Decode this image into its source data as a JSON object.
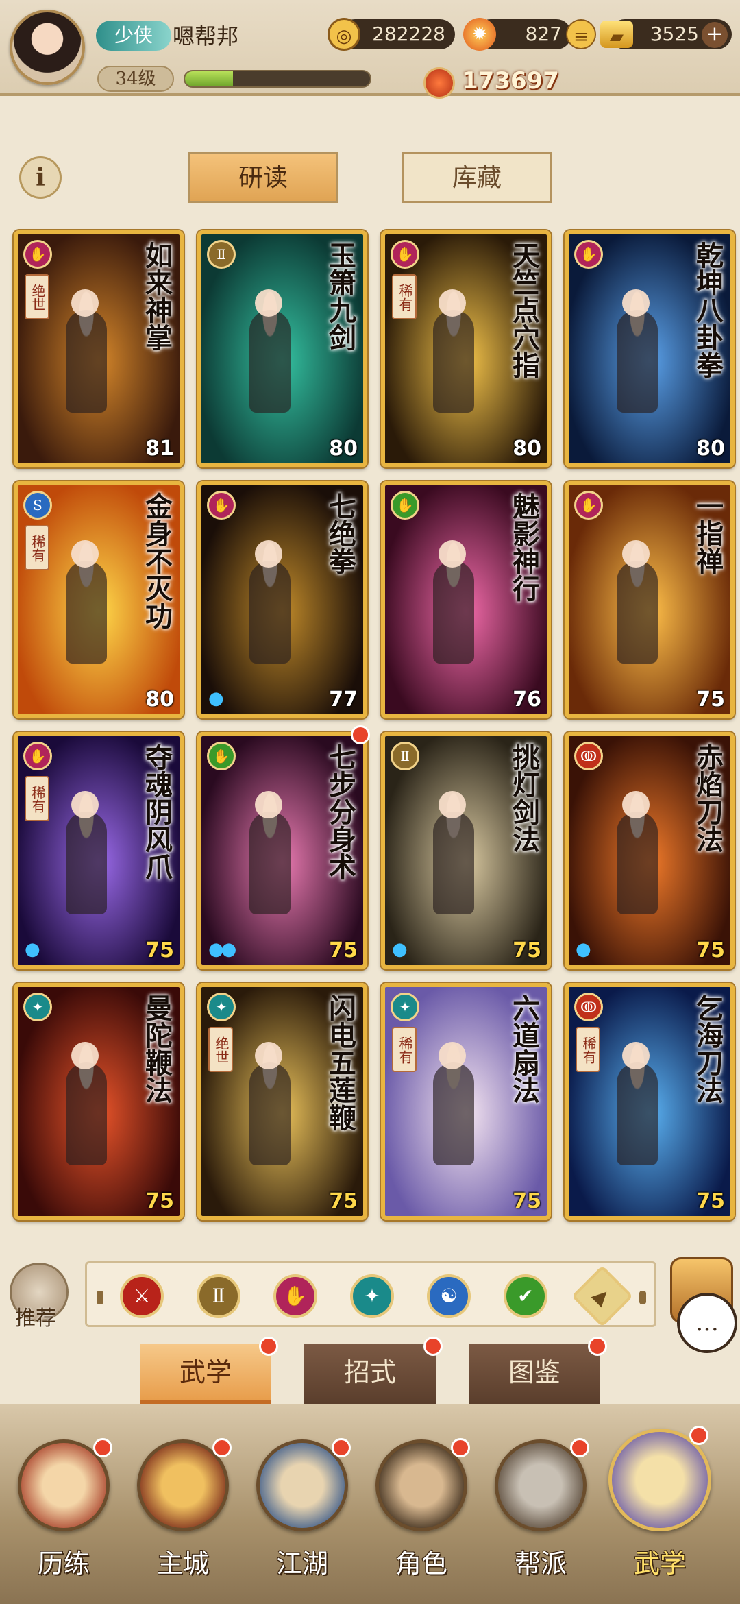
{
  "player": {
    "title_badge": "少侠",
    "name": "嗯帮邦",
    "level": "34级",
    "exp_fraction": 0.26,
    "power": "173697"
  },
  "resources": {
    "coins": "282228",
    "stamina": "827",
    "gold": "3525",
    "plus_icon": "plus-icon"
  },
  "header": {
    "info_symbol": "i",
    "tabs": [
      "研读",
      "库藏"
    ]
  },
  "cards": [
    {
      "name": "如来神掌",
      "level": "81",
      "rarity": "绝世",
      "type_color": "#b0245a",
      "bg": [
        "#3a1a0c",
        "#d4862a"
      ],
      "drops": 0
    },
    {
      "name": "玉箫九剑",
      "level": "80",
      "rarity": "",
      "type_color": "#8a6a2a",
      "bg": [
        "#0c3a34",
        "#34c0a0"
      ],
      "drops": 0
    },
    {
      "name": "天竺点穴指",
      "level": "80",
      "rarity": "稀有",
      "type_color": "#b0245a",
      "bg": [
        "#2a1a08",
        "#f2c24a"
      ],
      "drops": 0
    },
    {
      "name": "乾坤八卦拳",
      "level": "80",
      "rarity": "",
      "type_color": "#b0245a",
      "bg": [
        "#0a1a3a",
        "#5aa0e8"
      ],
      "drops": 0
    },
    {
      "name": "金身不灭功",
      "level": "80",
      "rarity": "稀有",
      "type_color": "#2a6ac0",
      "bg": [
        "#c04a0a",
        "#ffd84a"
      ],
      "drops": 0
    },
    {
      "name": "七绝拳",
      "level": "77",
      "rarity": "",
      "type_color": "#b0245a",
      "bg": [
        "#1a0e08",
        "#c08a2a"
      ],
      "drops": 1
    },
    {
      "name": "魅影神行",
      "level": "76",
      "rarity": "",
      "type_color": "#3a9a2a",
      "bg": [
        "#3a0a20",
        "#f06aa8"
      ],
      "drops": 0
    },
    {
      "name": "一指禅",
      "level": "75",
      "rarity": "",
      "type_color": "#b0245a",
      "bg": [
        "#6a2a08",
        "#ffc04a"
      ],
      "drops": 0
    },
    {
      "name": "夺魂阴风爪",
      "level": "75",
      "rarity": "稀有",
      "type_color": "#b0245a",
      "bg": [
        "#1a0a3a",
        "#9a6ae8"
      ],
      "drops": 1
    },
    {
      "name": "七步分身术",
      "level": "75",
      "rarity": "",
      "type_color": "#3a9a2a",
      "bg": [
        "#2a0a20",
        "#e87ab0"
      ],
      "drops": 2
    },
    {
      "name": "挑灯剑法",
      "level": "75",
      "rarity": "",
      "type_color": "#8a6a2a",
      "bg": [
        "#2a2418",
        "#d8c8a0"
      ],
      "drops": 1
    },
    {
      "name": "赤焰刀法",
      "level": "75",
      "rarity": "",
      "type_color": "#c0301a",
      "bg": [
        "#3a1206",
        "#f07a2a"
      ],
      "drops": 1
    },
    {
      "name": "曼陀鞭法",
      "level": "75",
      "rarity": "",
      "type_color": "#1a8a8a",
      "bg": [
        "#3a0a08",
        "#e8542a"
      ],
      "drops": 0
    },
    {
      "name": "闪电五莲鞭",
      "level": "75",
      "rarity": "绝世",
      "type_color": "#1a8a8a",
      "bg": [
        "#2a1a0a",
        "#e8c05a"
      ],
      "drops": 0
    },
    {
      "name": "六道扇法",
      "level": "75",
      "rarity": "稀有",
      "type_color": "#1a8a8a",
      "bg": [
        "#6a5aa8",
        "#f4e4f0"
      ],
      "drops": 0
    },
    {
      "name": "乞海刀法",
      "level": "75",
      "rarity": "稀有",
      "type_color": "#c0301a",
      "bg": [
        "#0a1a4a",
        "#5ab0f0"
      ],
      "drops": 0
    }
  ],
  "filter": {
    "recommend_label": "推荐",
    "icons": [
      {
        "name": "saber-filter-icon",
        "color": "#b8231a"
      },
      {
        "name": "sword-filter-icon",
        "color": "#8a6a2a"
      },
      {
        "name": "fist-filter-icon",
        "color": "#b0245a"
      },
      {
        "name": "whip-filter-icon",
        "color": "#1a8a8a"
      },
      {
        "name": "internal-filter-icon",
        "color": "#2a6ac0"
      },
      {
        "name": "agility-filter-icon",
        "color": "#3a9a2a"
      },
      {
        "name": "upgrade-filter-icon",
        "color": "#e8d28a"
      }
    ]
  },
  "subtabs": [
    "武学",
    "招式",
    "图鉴"
  ],
  "nav": [
    "历练",
    "主城",
    "江湖",
    "角色",
    "帮派",
    "武学"
  ],
  "chat_icon": "chat-bubble-icon"
}
